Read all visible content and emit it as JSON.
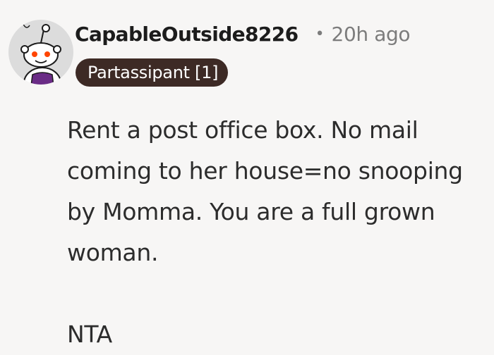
{
  "comment": {
    "username": "CapableOutside8226",
    "separator": "•",
    "timestamp": "20h ago",
    "flair": "Partassipant [1]",
    "paragraphs": [
      "Rent a post office box. No mail coming to her house=no snooping by Momma. You are a full grown woman.",
      "NTA"
    ],
    "avatar_icon": "snoo-avatar-icon"
  },
  "colors": {
    "background": "#f7f6f5",
    "flair_background": "#3d2a25",
    "flair_text": "#ffffff",
    "meta_text": "#7c7c7c"
  }
}
